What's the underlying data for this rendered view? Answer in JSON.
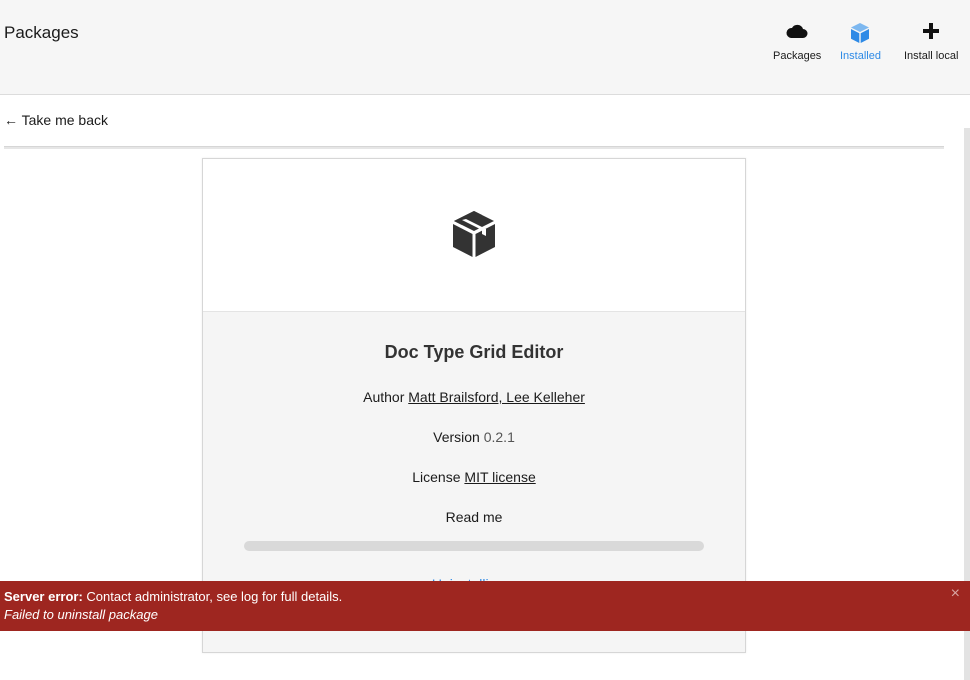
{
  "header": {
    "title": "Packages",
    "nav": [
      {
        "label": "Packages",
        "icon": "cloud-icon"
      },
      {
        "label": "Installed",
        "icon": "box-icon",
        "active": true
      },
      {
        "label": "Install local",
        "icon": "plus-icon"
      }
    ]
  },
  "back": {
    "label": "← Take me back"
  },
  "package": {
    "name": "Doc Type Grid Editor",
    "author_label": "Author",
    "author_value": "Matt Brailsford, Lee Kelleher",
    "version_label": "Version",
    "version_value": "0.2.1",
    "license_label": "License",
    "license_value": "MIT license",
    "readme_label": "Read me",
    "progress": 0,
    "status": "Uninstalling"
  },
  "error": {
    "title": "Server error:",
    "message": "Contact administrator, see log for full details.",
    "detail": "Failed to uninstall package",
    "close": "×"
  },
  "colors": {
    "accent": "#2e8ae6",
    "error_bg": "#9e2620",
    "header_bg": "#f6f6f6"
  }
}
